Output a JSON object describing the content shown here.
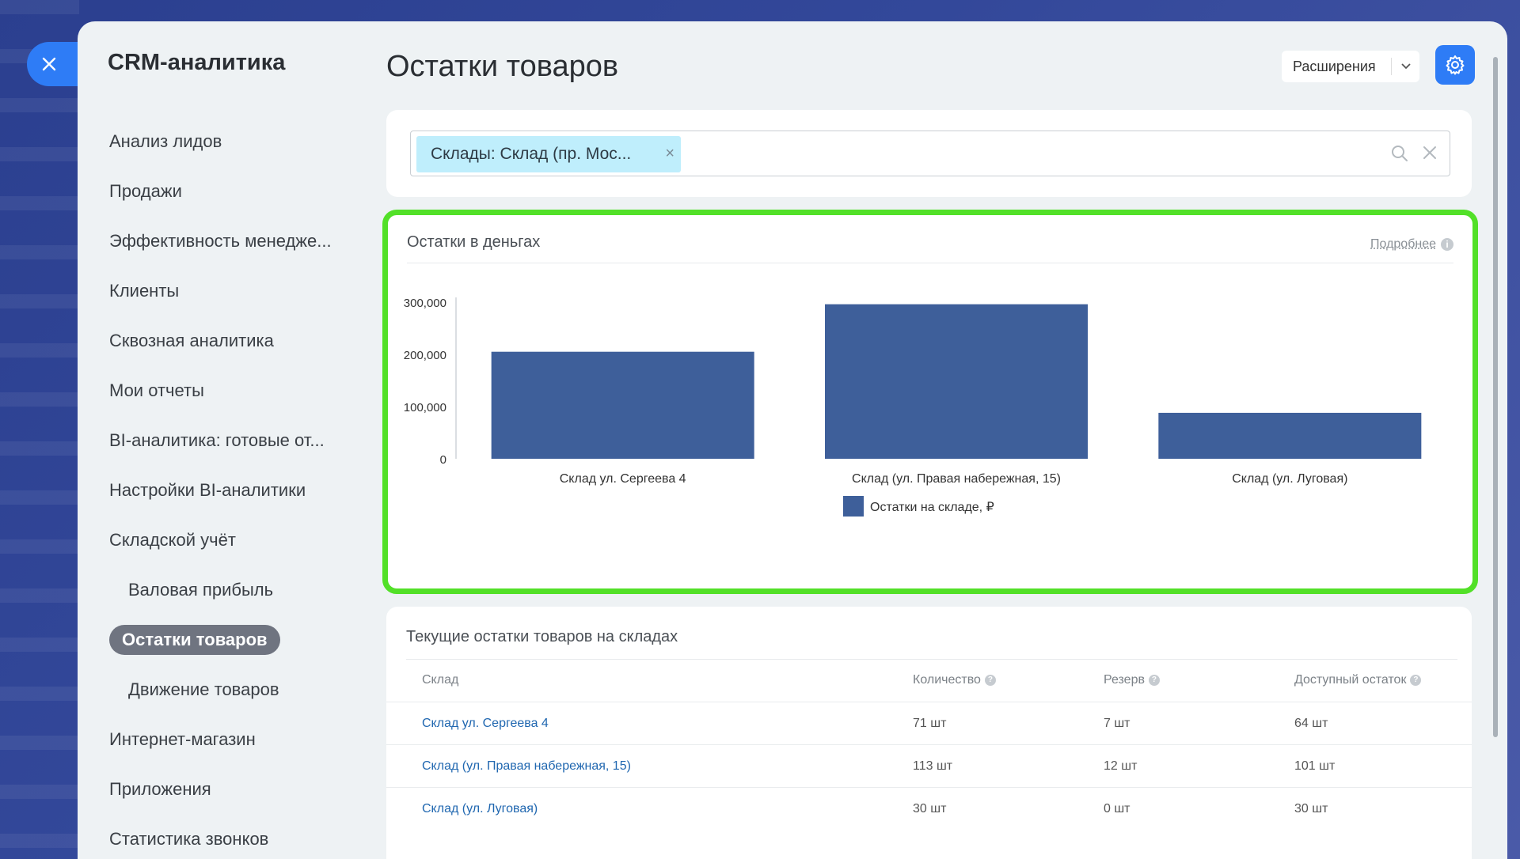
{
  "sidebar": {
    "title": "CRM-аналитика",
    "items": [
      {
        "label": "Анализ лидов",
        "sub": false,
        "active": false
      },
      {
        "label": "Продажи",
        "sub": false,
        "active": false
      },
      {
        "label": "Эффективность менедже...",
        "sub": false,
        "active": false
      },
      {
        "label": "Клиенты",
        "sub": false,
        "active": false
      },
      {
        "label": "Сквозная аналитика",
        "sub": false,
        "active": false
      },
      {
        "label": "Мои отчеты",
        "sub": false,
        "active": false
      },
      {
        "label": "BI-аналитика: готовые от...",
        "sub": false,
        "active": false
      },
      {
        "label": "Настройки BI-аналитики",
        "sub": false,
        "active": false
      },
      {
        "label": "Складской учёт",
        "sub": false,
        "active": false
      },
      {
        "label": "Валовая прибыль",
        "sub": true,
        "active": false
      },
      {
        "label": "Остатки товаров",
        "sub": true,
        "active": true
      },
      {
        "label": "Движение товаров",
        "sub": true,
        "active": false
      },
      {
        "label": "Интернет-магазин",
        "sub": false,
        "active": false
      },
      {
        "label": "Приложения",
        "sub": false,
        "active": false
      },
      {
        "label": "Статистика звонков",
        "sub": false,
        "active": false
      }
    ]
  },
  "header": {
    "title": "Остатки товаров",
    "extensions_label": "Расширения"
  },
  "filter": {
    "tag_label": "Склады: Склад (пр. Мос..."
  },
  "chart_card": {
    "title": "Остатки в деньгах",
    "more_label": "Подробнее"
  },
  "chart_data": {
    "type": "bar",
    "categories": [
      "Склад ул. Сергеева 4",
      "Склад (ул. Правая набережная, 15)",
      "Склад (ул. Луговая)"
    ],
    "series": [
      {
        "name": "Остатки на складе, ₽",
        "values": [
          205000,
          296000,
          88000
        ]
      }
    ],
    "ylim": [
      0,
      300000
    ],
    "yticks": [
      0,
      100000,
      200000,
      300000
    ],
    "ytick_labels": [
      "0",
      "100,000",
      "200,000",
      "300,000"
    ],
    "color": "#3e5f9a",
    "legend": "bottom-center",
    "grid": false
  },
  "table": {
    "title": "Текущие остатки товаров на складах",
    "headers": [
      "Склад",
      "Количество",
      "Резерв",
      "Доступный остаток"
    ],
    "rows": [
      [
        "Склад ул. Сергеева 4",
        "71 шт",
        "7 шт",
        "64 шт"
      ],
      [
        "Склад (ул. Правая набережная, 15)",
        "113 шт",
        "12 шт",
        "101 шт"
      ],
      [
        "Склад (ул. Луговая)",
        "30 шт",
        "0 шт",
        "30 шт"
      ]
    ]
  },
  "colors": {
    "accent": "#2e7cf6",
    "highlight_border": "#52e028",
    "bar": "#3e5f9a",
    "link": "#2067b0"
  }
}
